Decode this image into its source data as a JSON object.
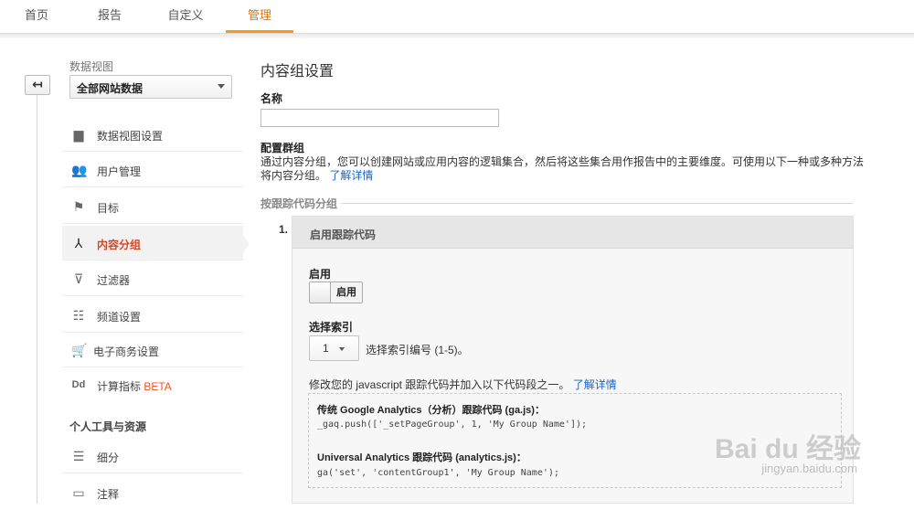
{
  "nav": {
    "tabs": [
      "首页",
      "报告",
      "自定义",
      "管理"
    ],
    "active_index": 3
  },
  "sidebar": {
    "back_glyph": "↤",
    "view_label": "数据视图",
    "view_select": "全部网站数据",
    "items": [
      {
        "label": "数据视图设置",
        "icon": "document-icon",
        "glyph": "▆"
      },
      {
        "label": "用户管理",
        "icon": "users-icon",
        "glyph": "👥"
      },
      {
        "label": "目标",
        "icon": "flag-icon",
        "glyph": "⚑"
      },
      {
        "label": "内容分组",
        "icon": "content-group-icon",
        "glyph": "⅄",
        "active": true
      },
      {
        "label": "过滤器",
        "icon": "filter-icon",
        "glyph": "⊽"
      },
      {
        "label": "频道设置",
        "icon": "channel-icon",
        "glyph": "☷"
      },
      {
        "label": "电子商务设置",
        "icon": "cart-icon",
        "glyph": "🛒"
      },
      {
        "label": "计算指标",
        "beta": "BETA",
        "icon": "calculated-metrics-icon",
        "glyph": "Dd"
      }
    ],
    "section_title": "个人工具与资源",
    "tools": [
      {
        "label": "细分",
        "icon": "segments-icon",
        "glyph": "☰"
      },
      {
        "label": "注释",
        "icon": "annotation-icon",
        "glyph": "▭"
      }
    ]
  },
  "main": {
    "title": "内容组设置",
    "name_label": "名称",
    "name_value": "",
    "config_label": "配置群组",
    "config_desc": "通过内容分组，您可以创建网站或应用内容的逻辑集合，然后将这些集合用作报告中的主要维度。可使用以下一种或多种方法将内容分组。",
    "config_link": "了解详情",
    "group_header": "按跟踪代码分组",
    "step_number": "1.",
    "panel_title": "启用跟踪代码",
    "enable_label": "启用",
    "toggle_text": "启用",
    "index_label": "选择索引",
    "index_value": "1",
    "index_hint": "选择索引编号 (1-5)。",
    "modify_text": "修改您的 javascript 跟踪代码并加入以下代码段之一。",
    "modify_link": "了解详情",
    "code1_title": "传统 Google Analytics（分析）跟踪代码 (ga.js)：",
    "code1": "_gaq.push(['_setPageGroup', 1, 'My Group Name']);",
    "code2_title": "Universal Analytics 跟踪代码 (analytics.js)：",
    "code2": "ga('set', 'contentGroup1', 'My Group Name');"
  },
  "watermark": {
    "brand": "Bai du 经验",
    "url": "jingyan.baidu.com"
  },
  "colors": {
    "accent_orange": "#f39c12",
    "active_text": "#d44726",
    "link": "#1a64c6"
  }
}
